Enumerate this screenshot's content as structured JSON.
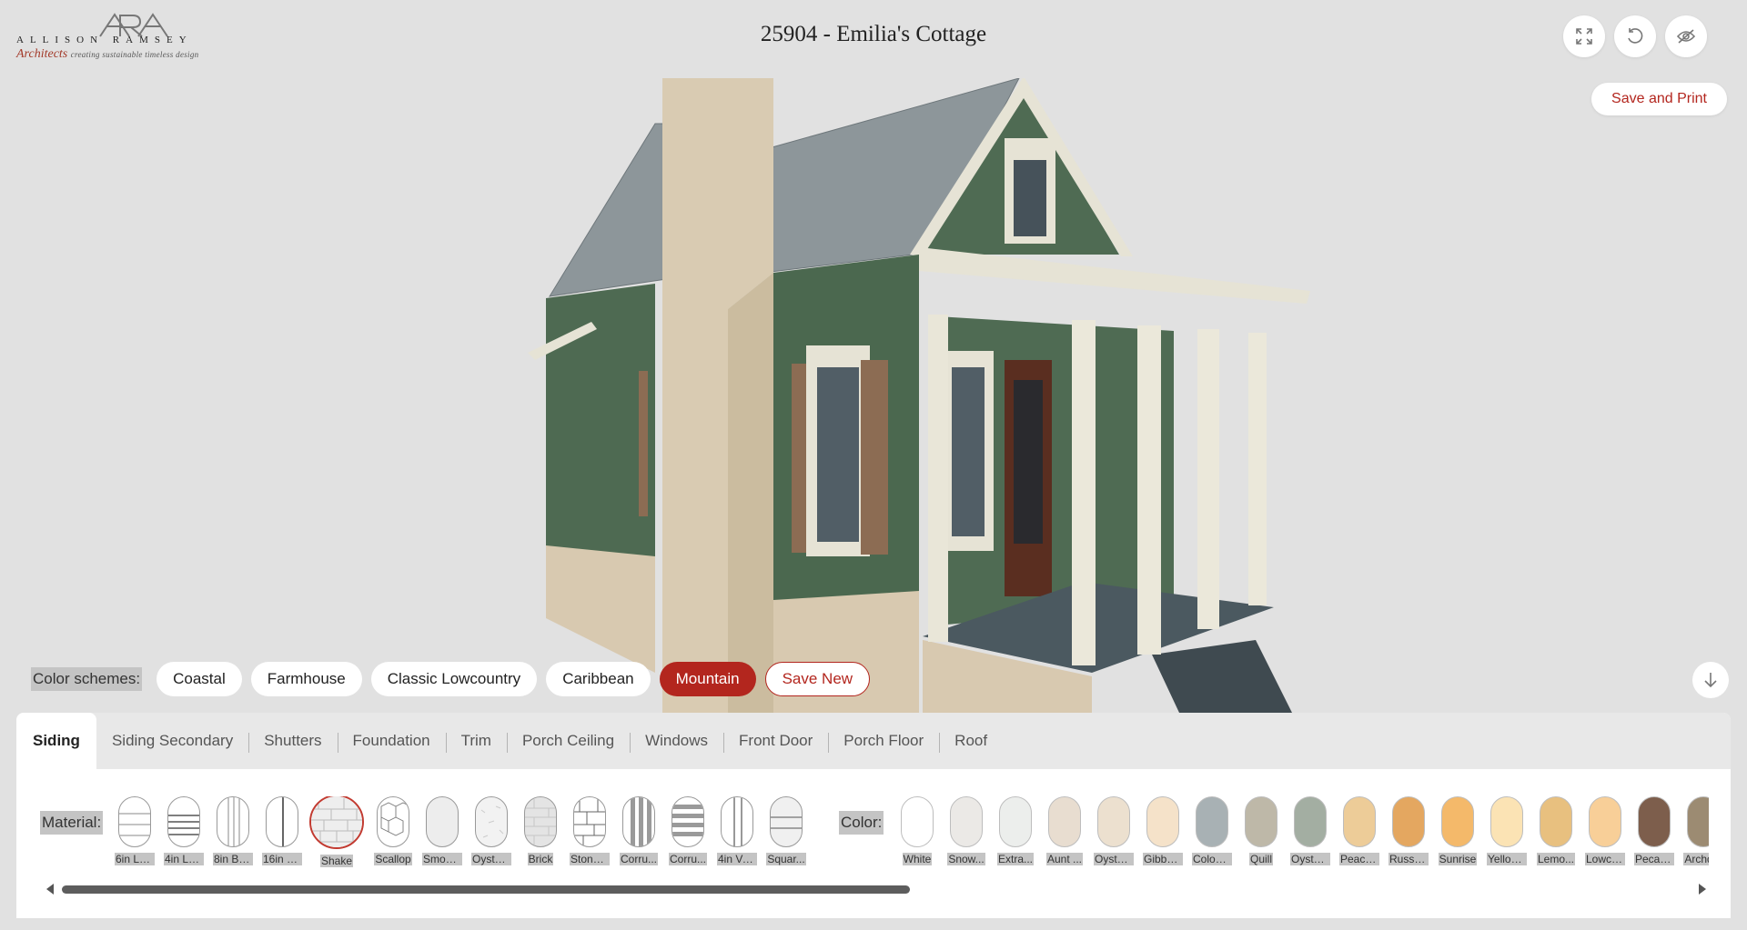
{
  "brand": {
    "firm": "ALLISON RAMSEY",
    "sub": "Architects",
    "tagline": "creating sustainable timeless design"
  },
  "title": "25904 - Emilia's Cottage",
  "toolbar": {
    "save_print_label": "Save and Print",
    "icons": [
      "fullscreen-icon",
      "reset-icon",
      "hide-icon"
    ]
  },
  "schemes": {
    "label": "Color schemes:",
    "items": [
      "Coastal",
      "Farmhouse",
      "Classic Lowcountry",
      "Caribbean",
      "Mountain"
    ],
    "active": "Mountain",
    "save_new_label": "Save New"
  },
  "tabs": {
    "items": [
      "Siding",
      "Siding Secondary",
      "Shutters",
      "Foundation",
      "Trim",
      "Porch Ceiling",
      "Windows",
      "Front Door",
      "Porch Floor",
      "Roof"
    ],
    "active": "Siding"
  },
  "material": {
    "label": "Material:",
    "items": [
      "6in La...",
      "4in La...",
      "8in Bo...",
      "16in B...",
      "Shake",
      "Scallop",
      "Smoot...",
      "Oyster...",
      "Brick",
      "Stone ...",
      "Corru...",
      "Corru...",
      "4in Ve...",
      "Squar..."
    ],
    "selected": "Shake"
  },
  "color": {
    "label": "Color:",
    "items": [
      {
        "name": "White",
        "hex": "#ffffff"
      },
      {
        "name": "Snow...",
        "hex": "#ebe9e6"
      },
      {
        "name": "Extra...",
        "hex": "#eceeec"
      },
      {
        "name": "Aunt ...",
        "hex": "#e8ddd0"
      },
      {
        "name": "Oyster...",
        "hex": "#ece0cf"
      },
      {
        "name": "Gibbe...",
        "hex": "#f5e2c9"
      },
      {
        "name": "Coloni...",
        "hex": "#a8b1b4"
      },
      {
        "name": "Quill",
        "hex": "#beb8a8"
      },
      {
        "name": "Oyster...",
        "hex": "#a3aea2"
      },
      {
        "name": "Peace...",
        "hex": "#edcc98"
      },
      {
        "name": "Russel...",
        "hex": "#e4a760"
      },
      {
        "name": "Sunrise",
        "hex": "#f4b96a"
      },
      {
        "name": "Yellow...",
        "hex": "#fbe3b4"
      },
      {
        "name": "Lemo...",
        "hex": "#e8c07f"
      },
      {
        "name": "Lowco...",
        "hex": "#f8cf98"
      },
      {
        "name": "Pecan...",
        "hex": "#7d5e4c"
      },
      {
        "name": "Archd...",
        "hex": "#9c8b72"
      }
    ]
  },
  "colors": {
    "accent": "#b3261e",
    "siding": "#4f6b53",
    "roof": "#8c9599",
    "stone": "#d8c9b0",
    "trim": "#e6e3d5",
    "shutter": "#8c6c53",
    "door": "#5a2e20"
  }
}
